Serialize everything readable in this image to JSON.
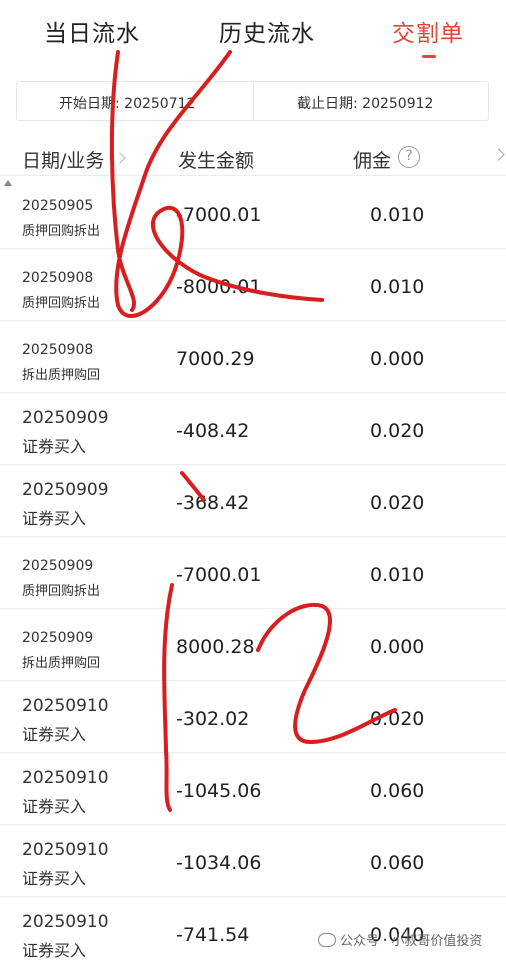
{
  "tabs": [
    {
      "label": "当日流水",
      "active": false
    },
    {
      "label": "历史流水",
      "active": false
    },
    {
      "label": "交割单",
      "active": true
    }
  ],
  "date_range": {
    "start_label": "开始日期:",
    "start_value": "20250712",
    "end_label": "截止日期:",
    "end_value": "20250912"
  },
  "table": {
    "headers": [
      "日期/业务",
      "发生金额",
      "佣金"
    ],
    "rows": [
      {
        "date": "20250905",
        "biz": "质押回购拆出",
        "amount": "-7000.01",
        "fee": "0.010"
      },
      {
        "date": "20250908",
        "biz": "质押回购拆出",
        "amount": "-8000.01",
        "fee": "0.010"
      },
      {
        "date": "20250908",
        "biz": "拆出质押购回",
        "amount": "7000.29",
        "fee": "0.000"
      },
      {
        "date": "20250909",
        "biz": "证券买入",
        "amount": "-408.42",
        "fee": "0.020"
      },
      {
        "date": "20250909",
        "biz": "证券买入",
        "amount": "-368.42",
        "fee": "0.020"
      },
      {
        "date": "20250909",
        "biz": "质押回购拆出",
        "amount": "-7000.01",
        "fee": "0.010"
      },
      {
        "date": "20250909",
        "biz": "拆出质押购回",
        "amount": "8000.28",
        "fee": "0.000"
      },
      {
        "date": "20250910",
        "biz": "证券买入",
        "amount": "-302.02",
        "fee": "0.020"
      },
      {
        "date": "20250910",
        "biz": "证券买入",
        "amount": "-1045.06",
        "fee": "0.060"
      },
      {
        "date": "20250910",
        "biz": "证券买入",
        "amount": "-1034.06",
        "fee": "0.060"
      },
      {
        "date": "20250910",
        "biz": "证券买入",
        "amount": "-741.54",
        "fee": "0.040"
      }
    ]
  },
  "watermark": "公众号 · 小叔哥价值投资",
  "colors": {
    "accent": "#e1463a",
    "annotation": "#d81e1e"
  },
  "icons": [
    "help-circle-icon",
    "chevron-down-icon",
    "chevron-right-icon",
    "sort-up-icon",
    "wechat-icon"
  ]
}
